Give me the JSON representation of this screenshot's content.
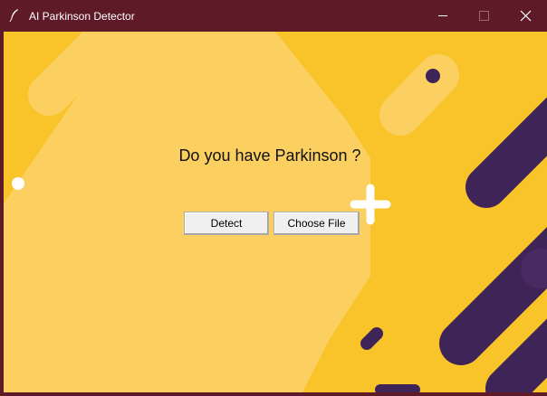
{
  "window": {
    "title": "AI Parkinson Detector",
    "icon": "feather-icon",
    "controls": [
      "minimize-icon",
      "maximize-icon",
      "close-icon"
    ]
  },
  "main": {
    "question": "Do you have Parkinson ?",
    "detect_label": "Detect",
    "choose_file_label": "Choose File"
  },
  "colors": {
    "titlebar": "#5e1a26",
    "background": "#f8c42a",
    "light_shape": "#fbd060",
    "purple": "#3f2458",
    "white_decor": "#ffffff"
  }
}
